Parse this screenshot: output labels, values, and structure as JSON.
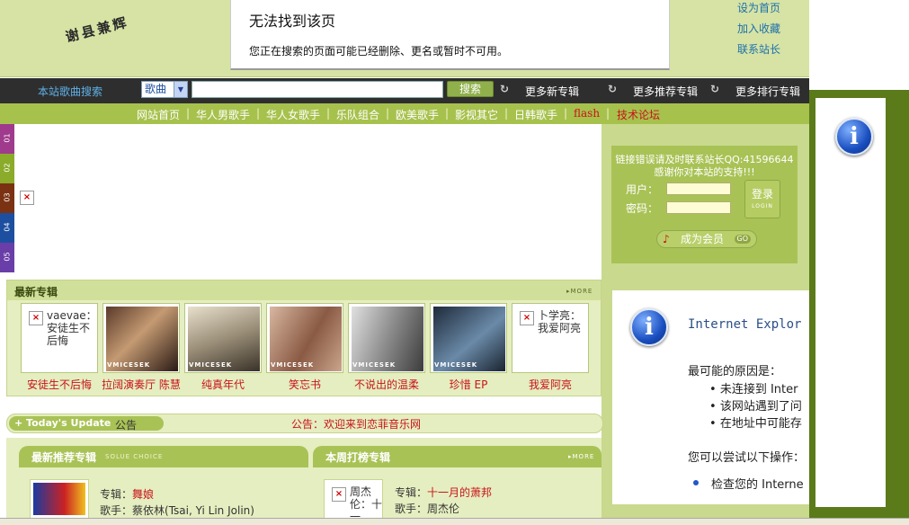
{
  "header": {
    "logo_text": "谢县兼辉"
  },
  "error_page": {
    "title": "无法找到该页",
    "message": "您正在搜索的页面可能已经删除、更名或暂时不可用。"
  },
  "top_links": [
    "设为首页",
    "加入收藏",
    "联系站长"
  ],
  "search": {
    "label": "本站歌曲搜索",
    "category": "歌曲",
    "query": "",
    "button": "搜索"
  },
  "more_links": [
    "更多新专辑",
    "更多推荐专辑",
    "更多排行专辑"
  ],
  "nav": {
    "items": [
      {
        "label": "网站首页"
      },
      {
        "label": "华人男歌手"
      },
      {
        "label": "华人女歌手"
      },
      {
        "label": "乐队组合"
      },
      {
        "label": "欧美歌手"
      },
      {
        "label": "影视其它"
      },
      {
        "label": "日韩歌手"
      },
      {
        "label": "flash"
      },
      {
        "label": "技术论坛"
      }
    ]
  },
  "side_tabs": [
    "01",
    "02",
    "03",
    "04",
    "05"
  ],
  "login": {
    "note_line1": "链接错误请及时联系站长QQ:41596644",
    "note_line2": "感谢你对本站的支持!!!",
    "user_label": "用户：",
    "pass_label": "密码：",
    "button": "登录",
    "button_sub": "LOGIN",
    "member_button": "成为会员",
    "member_badge": "GO"
  },
  "ie_error": {
    "title": "Internet Explor",
    "reason_heading": "最可能的原因是：",
    "reasons": [
      "未连接到 Inter",
      "该网站遇到了问",
      "在地址中可能存"
    ],
    "try_heading": "您可以尝试以下操作：",
    "actions": [
      "检查您的 Interne"
    ]
  },
  "new_albums": {
    "title": "最新专辑",
    "more": "MORE",
    "items": [
      {
        "caption": "安徒生不后悔",
        "thumb_text": "vaevae：安徒生不后悔",
        "watermark": ""
      },
      {
        "caption": "拉阔演奏厅 陈慧",
        "thumb_text": "",
        "watermark": "VMICESEK"
      },
      {
        "caption": "纯真年代",
        "thumb_text": "",
        "watermark": "VMICESEK"
      },
      {
        "caption": "笑忘书",
        "thumb_text": "",
        "watermark": "VMICESEK"
      },
      {
        "caption": "不说出的温柔",
        "thumb_text": "",
        "watermark": "VMICESEK"
      },
      {
        "caption": "珍惜 EP",
        "thumb_text": "",
        "watermark": "VMICESEK"
      },
      {
        "caption": "我爱阿亮",
        "thumb_text": "卜学亮：我爱阿亮",
        "watermark": ""
      }
    ]
  },
  "today_update": {
    "label": "+ Today's Update",
    "notice_label": "公告",
    "notice_text": "公告：欢迎来到恋菲音乐网"
  },
  "recommended": {
    "title": "最新推荐专辑",
    "subtitle": "SOLUE CHOICE",
    "album_label": "专辑：",
    "album": "舞娘",
    "artist_label": "歌手：",
    "artist": "蔡依林(Tsai, Yi Lin Jolin)"
  },
  "weekly": {
    "title": "本周打榜专辑",
    "more": "MORE",
    "album_label": "专辑：",
    "album": "十一月的萧邦",
    "artist_label": "歌手：",
    "artist": "周杰伦",
    "thumb_text": "周杰伦：十一"
  },
  "colors": {
    "band": "#d6e3a4",
    "nav": "#a7c14d",
    "accent_red": "#c8121b",
    "dark_bar": "#2e2e2e"
  }
}
